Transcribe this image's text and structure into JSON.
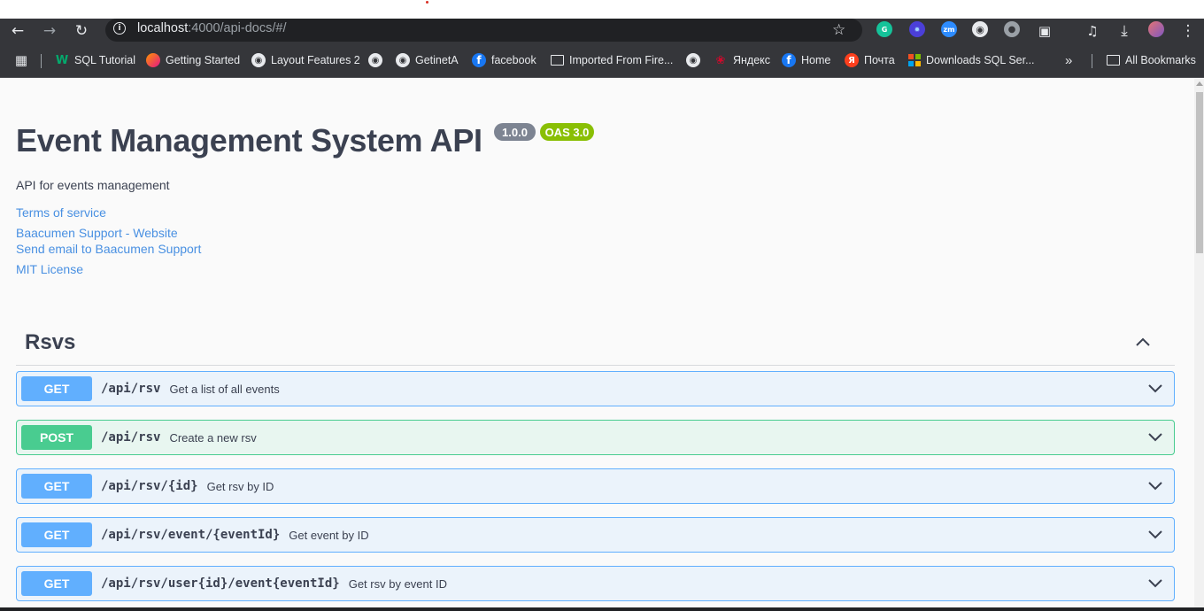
{
  "browser": {
    "url_host": "localhost",
    "url_path": ":4000/api-docs/#/"
  },
  "bookmarks": [
    {
      "label": "SQL Tutorial",
      "icon": "w3schools-icon"
    },
    {
      "label": "Getting Started",
      "icon": "firefox-icon"
    },
    {
      "label": "Layout Features 2",
      "icon": "globe-icon"
    },
    {
      "label": "",
      "icon": "globe-icon"
    },
    {
      "label": "GetinetA",
      "icon": "globe-icon"
    },
    {
      "label": "facebook",
      "icon": "facebook-icon"
    },
    {
      "label": "Imported From Fire...",
      "icon": "folder-icon"
    },
    {
      "label": "",
      "icon": "globe-icon"
    },
    {
      "label": "Яндекс",
      "icon": "huawei-icon"
    },
    {
      "label": "Home",
      "icon": "facebook-icon"
    },
    {
      "label": "Почта",
      "icon": "yandex-icon"
    },
    {
      "label": "Downloads SQL Ser...",
      "icon": "microsoft-icon"
    }
  ],
  "all_bookmarks_label": "All Bookmarks",
  "api": {
    "title": "Event Management System API",
    "version": "1.0.0",
    "oas": "OAS 3.0",
    "description": "API for events management",
    "links": {
      "terms": "Terms of service",
      "support_website": "Baacumen Support - Website",
      "support_email": "Send email to Baacumen Support",
      "license": "MIT License"
    }
  },
  "section": {
    "title": "Rsvs",
    "operations": [
      {
        "method": "GET",
        "path": "/api/rsv",
        "summary": "Get a list of all events"
      },
      {
        "method": "POST",
        "path": "/api/rsv",
        "summary": "Create a new rsv"
      },
      {
        "method": "GET",
        "path": "/api/rsv/{id}",
        "summary": "Get rsv by ID"
      },
      {
        "method": "GET",
        "path": "/api/rsv/event/{eventId}",
        "summary": "Get event by ID"
      },
      {
        "method": "GET",
        "path": "/api/rsv/user{id}/event{eventId}",
        "summary": "Get rsv by event ID"
      }
    ]
  }
}
